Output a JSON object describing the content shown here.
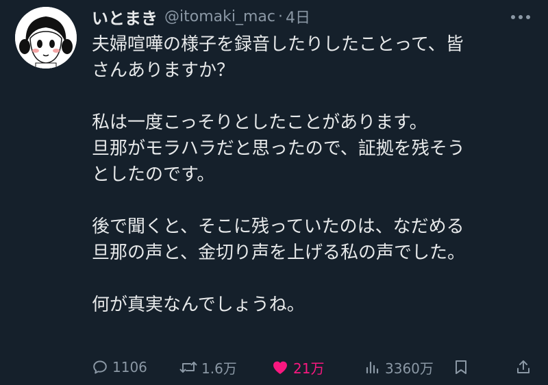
{
  "tweet": {
    "author_name": "いとまき",
    "author_handle": "@itomaki_mac",
    "separator": "·",
    "timestamp": "4日",
    "text_lines": [
      "夫婦喧嘩の様子を録音したりしたことって、皆",
      "さんありますか？",
      "",
      "私は一度こっそりとしたことがあります。",
      "旦那がモラハラだと思ったので、証拠を残そう",
      "としたのです。",
      "",
      "後で聞くと、そこに残っていたのは、なだめる",
      "旦那の声と、金切り声を上げる私の声でした。",
      "",
      "何が真実なんでしょうね。"
    ]
  },
  "actions": {
    "reply_count": "1106",
    "retweet_count": "1.6万",
    "like_count": "21万",
    "like_state": "liked",
    "view_count": "3360万"
  },
  "icons": {
    "more": "more-dots-icon",
    "reply": "reply-bubble-icon",
    "retweet": "retweet-arrows-icon",
    "like": "heart-icon",
    "views": "views-bar-chart-icon",
    "bookmark": "bookmark-icon",
    "share": "share-upload-icon"
  },
  "colors": {
    "background": "#15202b",
    "text": "#e7e9ea",
    "secondary": "#8b98a5",
    "like_active": "#f91880"
  }
}
